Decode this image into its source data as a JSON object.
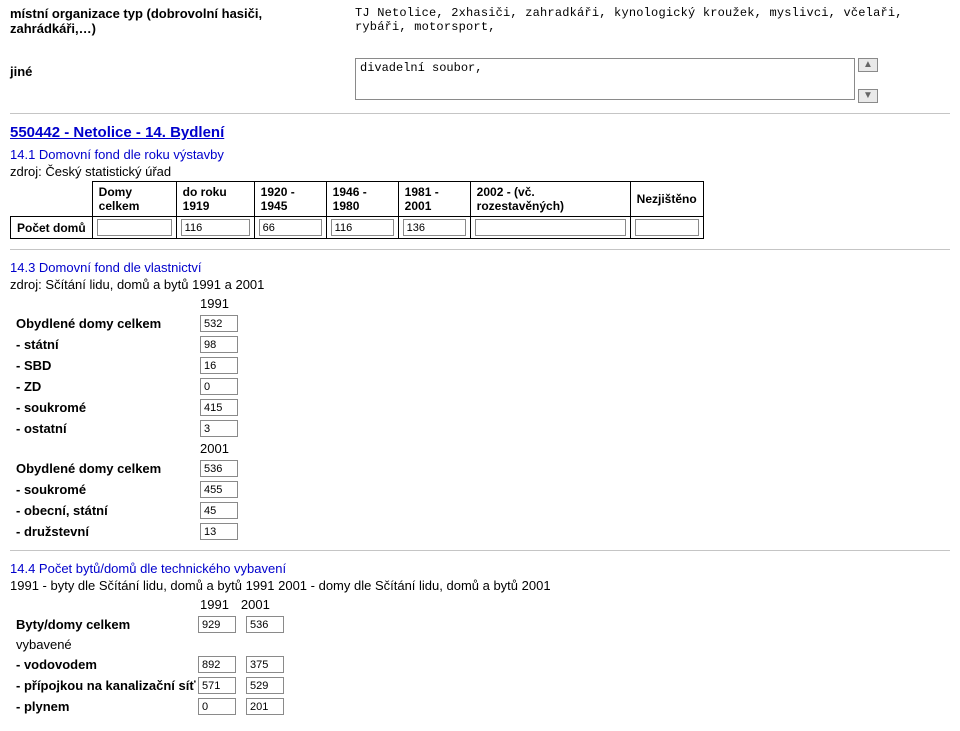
{
  "top": {
    "label_org": "místní organizace typ (dobrovolní hasiči, zahrádkáři,…)",
    "org_value": "TJ Netolice, 2xhasiči, zahradkáři, kynologický kroužek, myslivci, včelaři, rybáři, motorsport,",
    "jine_label": "jiné",
    "jine_value": "divadelní soubor,"
  },
  "section_title": "550442 - Netolice - 14. Bydlení",
  "s14_1": {
    "title": "14.1 Domovní fond dle roku výstavby",
    "source": "zdroj: Český statistický úřad",
    "row_label": "Počet domů",
    "cols": [
      "Domy celkem",
      "do roku 1919",
      "1920 - 1945",
      "1946 - 1980",
      "1981 - 2001",
      "2002 - (vč. rozestavěných)",
      "Nezjištěno"
    ],
    "vals": [
      "",
      "116",
      "66",
      "116",
      "136",
      "",
      ""
    ]
  },
  "s14_3": {
    "title": "14.3 Domovní fond dle vlastnictví",
    "source": "zdroj: Sčítání lidu, domů a bytů 1991 a 2001",
    "year1": "1991",
    "rows1": [
      {
        "label": "Obydlené domy celkem",
        "val": "532"
      },
      {
        "label": "- státní",
        "val": "98"
      },
      {
        "label": "- SBD",
        "val": "16"
      },
      {
        "label": "- ZD",
        "val": "0"
      },
      {
        "label": "- soukromé",
        "val": "415"
      },
      {
        "label": "- ostatní",
        "val": "3"
      }
    ],
    "year2": "2001",
    "rows2": [
      {
        "label": "Obydlené domy celkem",
        "val": "536"
      },
      {
        "label": "- soukromé",
        "val": "455"
      },
      {
        "label": "- obecní, státní",
        "val": "45"
      },
      {
        "label": "- družstevní",
        "val": "13"
      }
    ]
  },
  "s14_4": {
    "title": "14.4 Počet bytů/domů dle technického vybavení",
    "source": "1991 - byty dle Sčítání lidu, domů a bytů 1991 2001 - domy dle Sčítání lidu, domů a bytů 2001",
    "y1": "1991",
    "y2": "2001",
    "rows": [
      {
        "label": "Byty/domy celkem",
        "bold": true,
        "v1": "929",
        "v2": "536"
      },
      {
        "label": "vybavené",
        "bold": false,
        "v1": "",
        "v2": ""
      },
      {
        "label": "- vodovodem",
        "bold": true,
        "v1": "892",
        "v2": "375"
      },
      {
        "label": "- přípojkou na kanalizační síť",
        "bold": true,
        "v1": "571",
        "v2": "529"
      },
      {
        "label": "- plynem",
        "bold": true,
        "v1": "0",
        "v2": "201"
      }
    ]
  }
}
